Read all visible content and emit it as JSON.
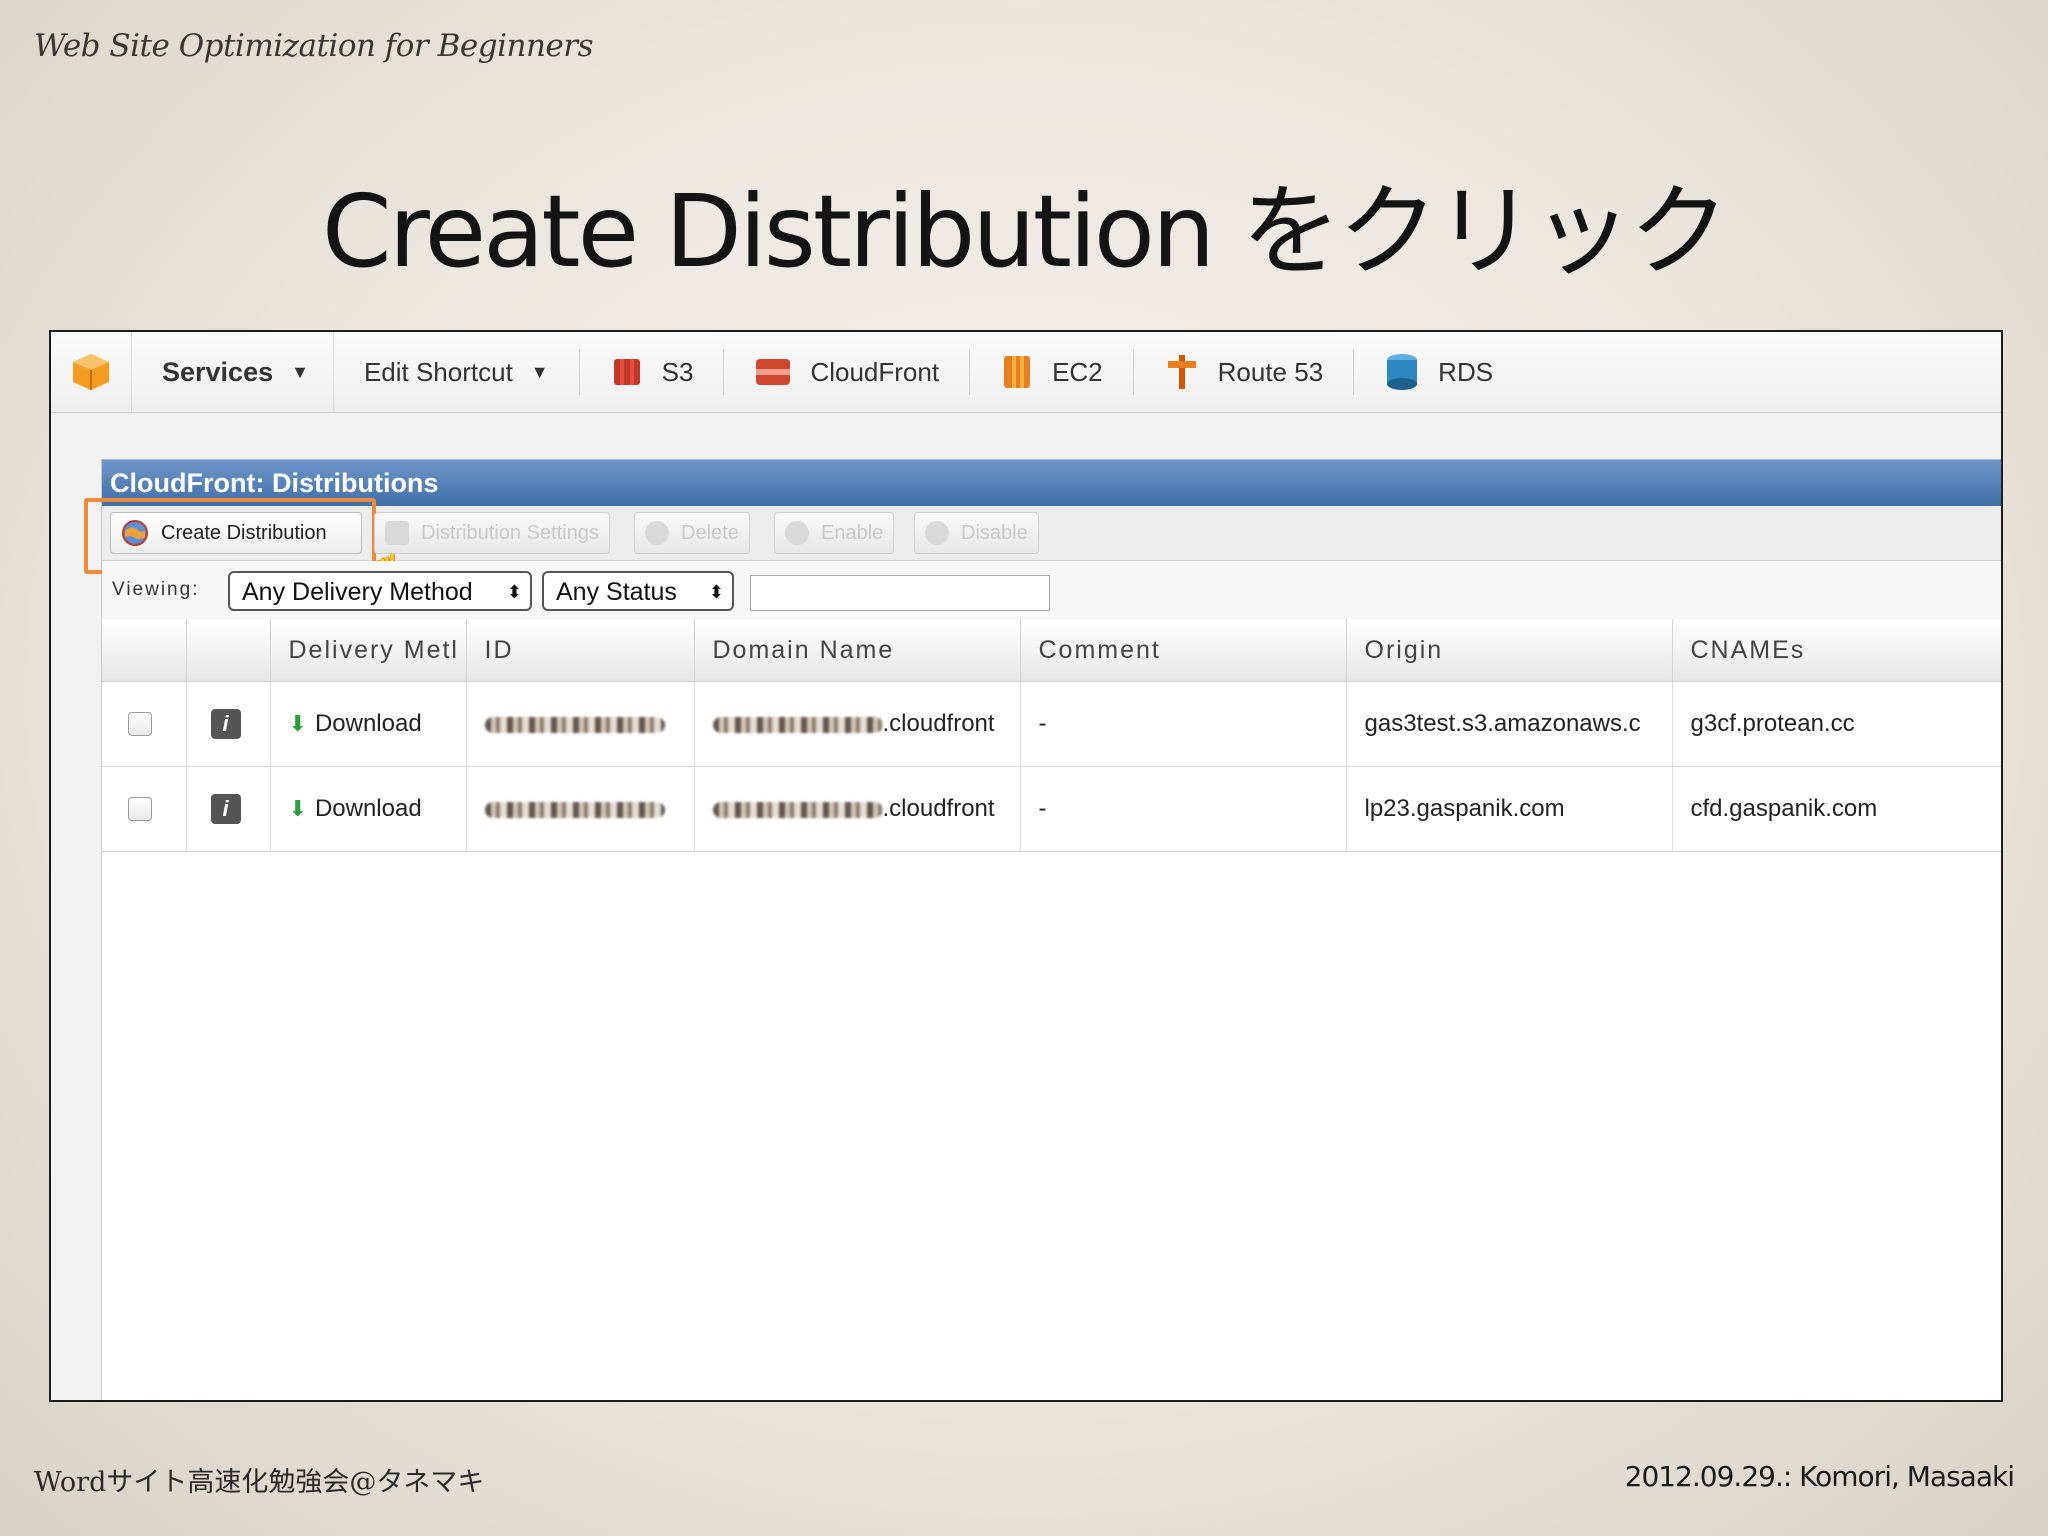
{
  "slide": {
    "header": "Web Site Optimization for Beginners",
    "title": "Create Distribution をクリック",
    "footer_left": "Wordサイト高速化勉強会@タネマキ",
    "footer_right": "2012.09.29.: Komori, Masaaki"
  },
  "nav": {
    "services": "Services",
    "edit_shortcut": "Edit Shortcut",
    "s3": "S3",
    "cloudfront": "CloudFront",
    "ec2": "EC2",
    "route53": "Route 53",
    "rds": "RDS"
  },
  "panel": {
    "title": "CloudFront: Distributions",
    "toolbar": {
      "create": "Create Distribution",
      "settings": "Distribution Settings",
      "delete": "Delete",
      "enable": "Enable",
      "disable": "Disable"
    },
    "viewing_label": "Viewing:",
    "delivery_select": "Any Delivery Method",
    "status_select": "Any Status",
    "search_value": ""
  },
  "table": {
    "headers": [
      "Delivery Metl",
      "ID",
      "Domain Name",
      "Comment",
      "Origin",
      "CNAMEs"
    ],
    "rows": [
      {
        "method": "Download",
        "domain_suffix": ".cloudfront",
        "comment": "-",
        "origin": "gas3test.s3.amazonaws.c",
        "cname": "g3cf.protean.cc"
      },
      {
        "method": "Download",
        "domain_suffix": ".cloudfront",
        "comment": "-",
        "origin": "lp23.gaspanik.com",
        "cname": "cfd.gaspanik.com"
      }
    ]
  },
  "colors": {
    "highlight": "#ea8a3a",
    "panel_bar": "#4a78b0"
  }
}
